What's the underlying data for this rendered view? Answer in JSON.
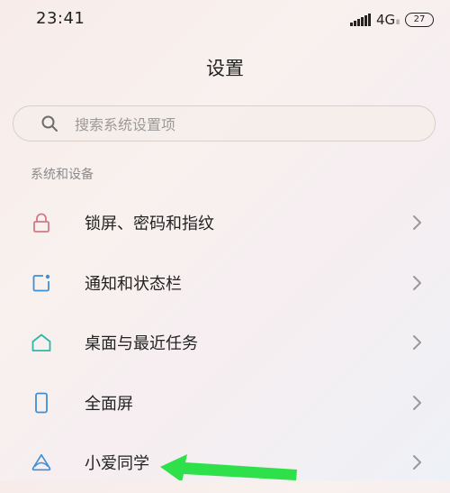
{
  "status_bar": {
    "time": "23:41",
    "network": "4G",
    "network_sub": "ll",
    "battery": "27"
  },
  "header": {
    "title": "设置"
  },
  "search": {
    "placeholder": "搜索系统设置项"
  },
  "section": {
    "title": "系统和设备",
    "items": [
      {
        "label": "锁屏、密码和指纹",
        "icon": "lock-icon",
        "color": "#d07a86"
      },
      {
        "label": "通知和状态栏",
        "icon": "notification-icon",
        "color": "#3f8fd6"
      },
      {
        "label": "桌面与最近任务",
        "icon": "home-icon",
        "color": "#2fb6a6"
      },
      {
        "label": "全面屏",
        "icon": "phone-icon",
        "color": "#3f8fd6"
      },
      {
        "label": "小爱同学",
        "icon": "xiaoai-icon",
        "color": "#3f8fd6"
      }
    ]
  },
  "annotation": {
    "arrow_color": "#2ee04a"
  }
}
